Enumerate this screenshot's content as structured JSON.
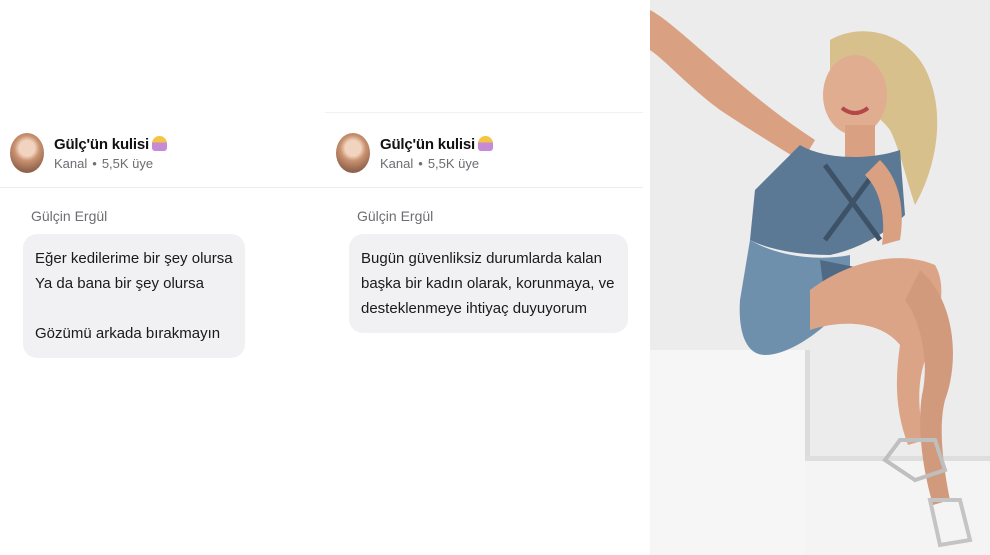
{
  "left_panel": {
    "channel": {
      "name": "Gülç'ün kulisi",
      "type": "Kanal",
      "members": "5,5K üye",
      "emoji_icon": "woman-tipping-hand-emoji"
    },
    "message": {
      "sender": "Gülçin Ergül",
      "lines": [
        "Eğer kedilerime bir şey olursa",
        "Ya da bana bir şey olursa",
        "Gözümü arkada bırakmayın"
      ]
    }
  },
  "middle_panel": {
    "channel": {
      "name": "Gülç'ün kulisi",
      "type": "Kanal",
      "members": "5,5K üye",
      "emoji_icon": "woman-tipping-hand-emoji"
    },
    "message": {
      "sender": "Gülçin Ergül",
      "lines": [
        "Bugün güvenliksiz durumlarda kalan",
        "başka bir kadın olarak, korunmaya, ve",
        "desteklenmeye ihtiyaç duyuyorum"
      ]
    }
  },
  "colors": {
    "bubble": "#f1f1f4",
    "secondary_text": "#6d6d72",
    "primary_text": "#111111",
    "dress": "#5b7894"
  }
}
